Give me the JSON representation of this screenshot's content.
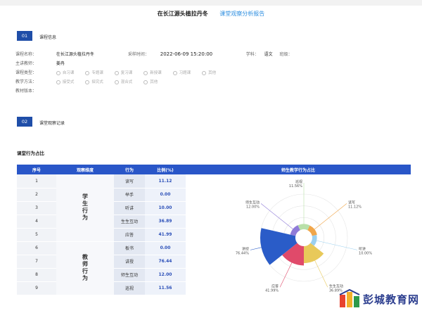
{
  "header": {
    "title": "在长江源头植拉丹冬",
    "subtitle": "课堂观察分析报告"
  },
  "section1": {
    "num": "01",
    "title": "课程信息"
  },
  "section2": {
    "num": "02",
    "title": "课堂观察记录"
  },
  "info": {
    "course_label": "课程名称：",
    "course_value": "在长江源头植拉丹冬",
    "time_label": "采样时间：",
    "time_value": "2022-06-09 15:20:00",
    "subject_label": "学科：",
    "subject_value": "语文",
    "grade_label": "班级：",
    "teacher_label": "主讲教师：",
    "teacher_value": "姜冉",
    "type_label": "课程类型：",
    "type_options": [
      "自习课",
      "专题课",
      "复习课",
      "新授课",
      "习题课",
      "其他"
    ],
    "method_label": "教学方法：",
    "method_options": [
      "接受式",
      "探究式",
      "混合式",
      "其他"
    ],
    "textbook_label": "教材版本："
  },
  "table": {
    "title": "课堂行为占比",
    "headers": [
      "序号",
      "观察维度",
      "行为",
      "比例(%)",
      "师生教学行为占比"
    ],
    "groups": [
      {
        "name": "学生行为",
        "rows": [
          {
            "idx": "1",
            "behavior": "读写",
            "pct": "11.12"
          },
          {
            "idx": "2",
            "behavior": "举手",
            "pct": "0.00"
          },
          {
            "idx": "3",
            "behavior": "听讲",
            "pct": "10.00"
          },
          {
            "idx": "4",
            "behavior": "生生互动",
            "pct": "36.89"
          },
          {
            "idx": "5",
            "behavior": "应答",
            "pct": "41.99"
          }
        ]
      },
      {
        "name": "教师行为",
        "rows": [
          {
            "idx": "6",
            "behavior": "板书",
            "pct": "0.00"
          },
          {
            "idx": "7",
            "behavior": "讲授",
            "pct": "76.44"
          },
          {
            "idx": "8",
            "behavior": "师生互动",
            "pct": "12.00"
          },
          {
            "idx": "9",
            "behavior": "巡视",
            "pct": "11.56"
          }
        ]
      }
    ]
  },
  "chart_data": {
    "type": "pie",
    "title": "师生教学行为占比",
    "categories": [
      "读写",
      "听讲",
      "生生互动",
      "应答",
      "讲授",
      "师生互动",
      "巡视"
    ],
    "values": [
      11.12,
      10.0,
      36.89,
      41.99,
      76.44,
      12.0,
      11.56
    ],
    "colors": [
      "#f0a64a",
      "#9bd0f0",
      "#e8c95a",
      "#e04a6a",
      "#2a5cc8",
      "#8f7bd8",
      "#b8e0a8"
    ],
    "labels": [
      {
        "name": "读写",
        "value": "11.12%"
      },
      {
        "name": "听讲",
        "value": "10.00%"
      },
      {
        "name": "生生互动",
        "value": "36.89%"
      },
      {
        "name": "应答",
        "value": "41.99%"
      },
      {
        "name": "讲授",
        "value": "76.44%"
      },
      {
        "name": "师生互动",
        "value": "12.00%"
      },
      {
        "name": "巡视",
        "value": "11.56%"
      }
    ]
  },
  "watermark": {
    "text": "彭城教育网"
  }
}
